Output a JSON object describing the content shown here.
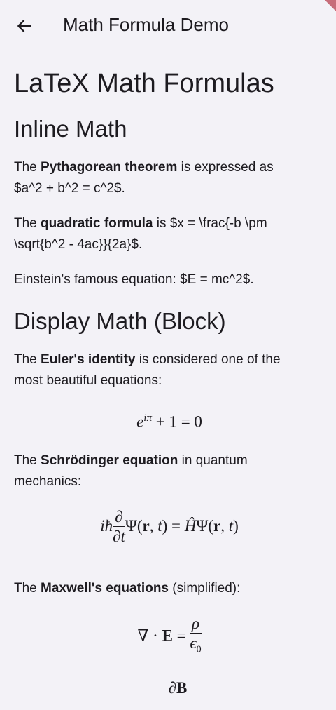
{
  "appbar": {
    "title": "Math Formula Demo",
    "back_icon": "arrow-left-icon"
  },
  "content": {
    "heading": "LaTeX Math Formulas",
    "inline_section": {
      "heading": "Inline Math",
      "p1": {
        "before": "The ",
        "bold": "Pythagorean theorem",
        "after": " is expressed as",
        "line2": "$a^2 + b^2 = c^2$."
      },
      "p2": {
        "before": "The ",
        "bold": "quadratic formula",
        "after": " is $x = \\frac{-b \\pm",
        "line2": "\\sqrt{b^2 - 4ac}}{2a}$."
      },
      "p3": "Einstein's famous equation: $E = mc^2$."
    },
    "display_section": {
      "heading": "Display Math (Block)",
      "euler": {
        "before": "The ",
        "bold": "Euler's identity",
        "after": " is considered one of the",
        "line2": "most beautiful equations:"
      },
      "schrodinger": {
        "before": "The ",
        "bold": "Schrödinger equation",
        "after": " in quantum",
        "line2": "mechanics:"
      },
      "maxwell": {
        "before": "The ",
        "bold": "Maxwell's equations",
        "after": " (simplified):"
      }
    }
  }
}
